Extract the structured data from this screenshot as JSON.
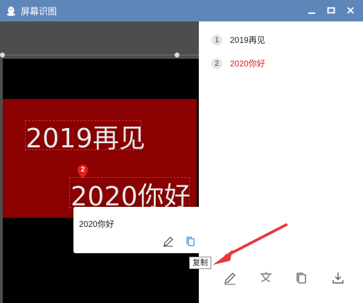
{
  "window": {
    "title": "屏幕识图"
  },
  "canvas": {
    "line1": "2019再见",
    "line2": "2020你好",
    "pin_number": "2"
  },
  "popup": {
    "text": "2020你好",
    "translate_label": "译"
  },
  "tooltip": {
    "copy": "复制"
  },
  "results": [
    {
      "index": "1",
      "text": "2019再见",
      "color": "#222222"
    },
    {
      "index": "2",
      "text": "2020你好",
      "color": "#e02020"
    }
  ],
  "colors": {
    "titlebar": "#5f86b9",
    "highlight_red": "#e02020",
    "arrow_red": "#e8383d",
    "copy_icon_blue": "#2d8cf0"
  }
}
